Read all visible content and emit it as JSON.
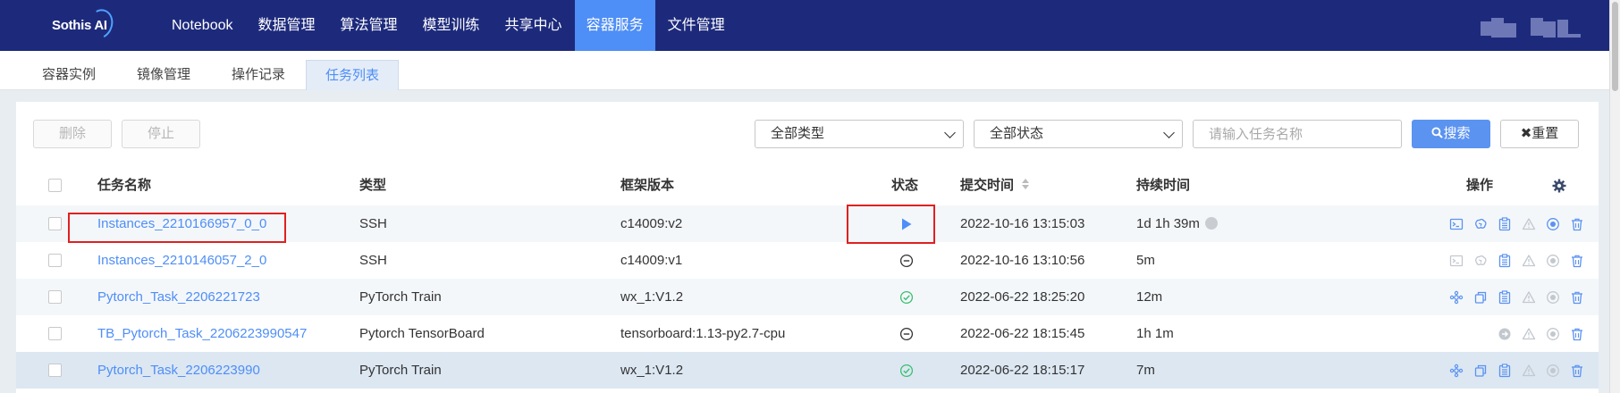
{
  "app": {
    "logo_text": "Sothis AI",
    "nav": [
      {
        "label": "Notebook"
      },
      {
        "label": "数据管理"
      },
      {
        "label": "算法管理"
      },
      {
        "label": "模型训练"
      },
      {
        "label": "共享中心"
      },
      {
        "label": "容器服务",
        "active": true
      },
      {
        "label": "文件管理"
      }
    ]
  },
  "subtabs": [
    {
      "label": "容器实例"
    },
    {
      "label": "镜像管理"
    },
    {
      "label": "操作记录"
    },
    {
      "label": "任务列表",
      "active": true
    }
  ],
  "toolbar": {
    "delete_label": "删除",
    "stop_label": "停止",
    "type_filter": "全部类型",
    "status_filter": "全部状态",
    "search_placeholder": "请输入任务名称",
    "search_label": "搜索",
    "reset_label": "重置"
  },
  "table": {
    "columns": {
      "name": "任务名称",
      "type": "类型",
      "framework": "框架版本",
      "status": "状态",
      "submit_time": "提交时间",
      "duration": "持续时间",
      "actions": "操作"
    },
    "rows": [
      {
        "name": "Instances_2210166957_0_0",
        "type": "SSH",
        "framework": "c14009:v2",
        "status": "running",
        "submit_time": "2022-10-16 13:15:03",
        "duration": "1d 1h 39m",
        "has_info": true,
        "actions": [
          "terminal-icon",
          "brain-icon",
          "log-icon",
          "warning-icon",
          "stop-icon",
          "delete-icon"
        ]
      },
      {
        "name": "Instances_2210146057_2_0",
        "type": "SSH",
        "framework": "c14009:v1",
        "status": "stopped",
        "submit_time": "2022-10-16 13:10:56",
        "duration": "5m",
        "has_info": false,
        "actions": [
          "terminal-icon",
          "brain-icon",
          "log-icon",
          "warning-icon",
          "stop-icon",
          "delete-icon"
        ]
      },
      {
        "name": "Pytorch_Task_2206221723",
        "type": "PyTorch Train",
        "framework": "wx_1:V1.2",
        "status": "success",
        "submit_time": "2022-06-22 18:25:20",
        "duration": "12m",
        "has_info": false,
        "actions": [
          "network-icon",
          "copy-icon",
          "log-icon",
          "warning-icon",
          "stop-icon",
          "delete-icon"
        ]
      },
      {
        "name": "TB_Pytorch_Task_2206223990547",
        "type": "Pytorch TensorBoard",
        "framework": "tensorboard:1.13-py2.7-cpu",
        "status": "stopped",
        "submit_time": "2022-06-22 18:15:45",
        "duration": "1h 1m",
        "has_info": false,
        "actions": [
          "open-icon",
          "warning-icon",
          "stop-icon",
          "delete-icon"
        ]
      },
      {
        "name": "Pytorch_Task_2206223990",
        "type": "PyTorch Train",
        "framework": "wx_1:V1.2",
        "status": "success",
        "submit_time": "2022-06-22 18:15:17",
        "duration": "7m",
        "has_info": false,
        "actions": [
          "network-icon",
          "copy-icon",
          "log-icon",
          "warning-icon",
          "stop-icon",
          "delete-icon"
        ]
      }
    ]
  },
  "colors": {
    "nav_bg": "#1d2a7c",
    "accent": "#4e8ef7",
    "success": "#3cbf72",
    "annotation": "#e02020"
  }
}
